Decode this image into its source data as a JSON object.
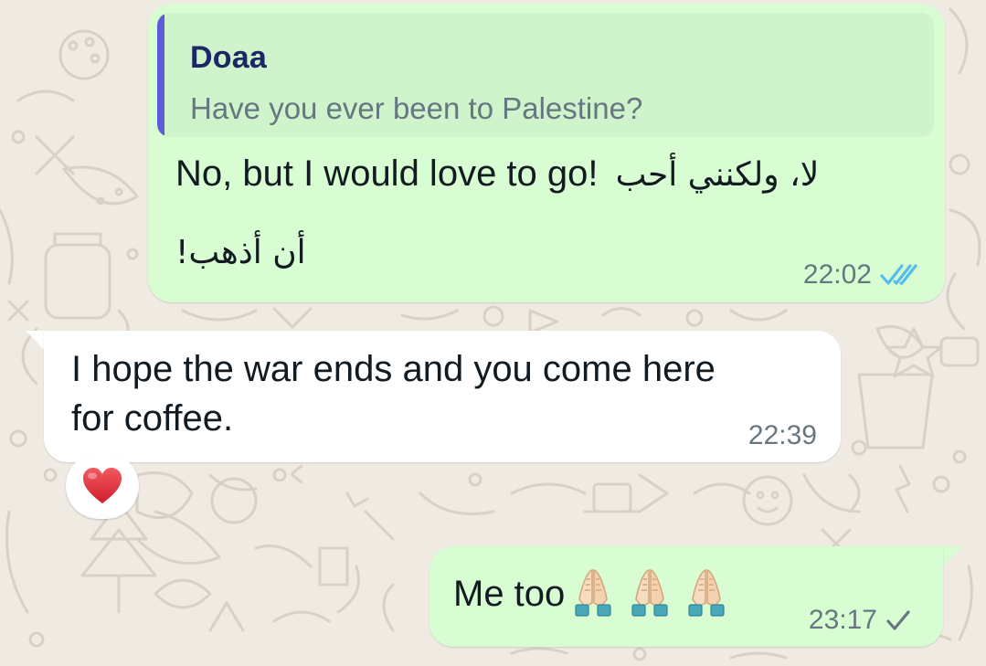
{
  "messages": [
    {
      "direction": "outgoing",
      "reply_to": {
        "author": "Doaa",
        "text": "Have you ever been to Palestine?",
        "accent_color": "#5e5cd6"
      },
      "text_en": "No, but I would love to go!",
      "text_ar_line1": "لا، ولكنني أحب",
      "text_ar_line2": "أن أذهب!",
      "time": "22:02",
      "status": "read",
      "status_icon": "double-check-icon",
      "status_color": "#53bdeb"
    },
    {
      "direction": "incoming",
      "text_line1": "I hope the war ends and you come here",
      "text_line2": "for coffee.",
      "time": "22:39",
      "reaction": "heart-icon",
      "reaction_color": "#e0323f"
    },
    {
      "direction": "outgoing",
      "text": "Me too",
      "emojis": [
        "folded-hands-icon",
        "folded-hands-icon",
        "folded-hands-icon"
      ],
      "time": "23:17",
      "status": "sent",
      "status_icon": "single-check-icon",
      "status_color": "#667781"
    }
  ],
  "colors": {
    "wallpaper": "#efeae2",
    "outgoing_bubble": "#d9fdd3",
    "incoming_bubble": "#ffffff",
    "text": "#111b21",
    "meta_text": "#667781"
  }
}
